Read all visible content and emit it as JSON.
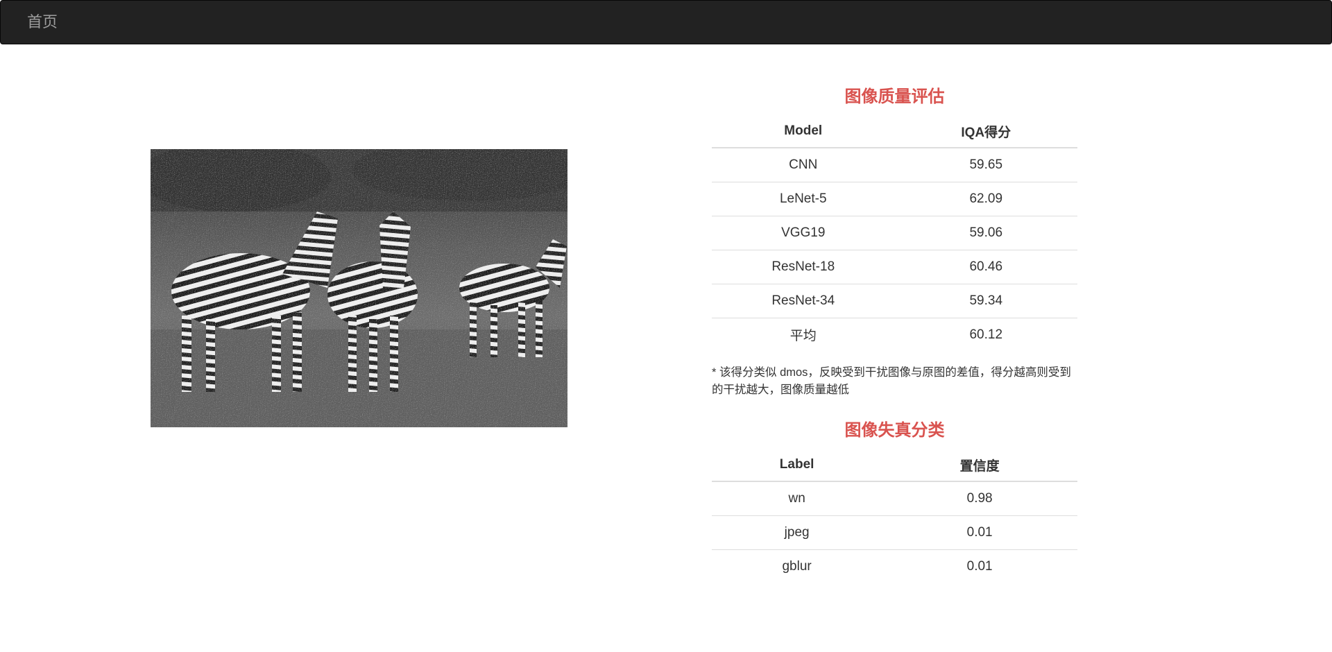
{
  "navbar": {
    "brand": "首页"
  },
  "image": {
    "alt": "zebras-noisy-grayscale-photo"
  },
  "iqa": {
    "title": "图像质量评估",
    "columns": [
      "Model",
      "IQA得分"
    ],
    "rows": [
      [
        "CNN",
        "59.65"
      ],
      [
        "LeNet-5",
        "62.09"
      ],
      [
        "VGG19",
        "59.06"
      ],
      [
        "ResNet-18",
        "60.46"
      ],
      [
        "ResNet-34",
        "59.34"
      ],
      [
        "平均",
        "60.12"
      ]
    ],
    "note": "* 该得分类似 dmos，反映受到干扰图像与原图的差值，得分越高则受到的干扰越大，图像质量越低"
  },
  "distortion": {
    "title": "图像失真分类",
    "columns": [
      "Label",
      "置信度"
    ],
    "rows": [
      [
        "wn",
        "0.98"
      ],
      [
        "jpeg",
        "0.01"
      ],
      [
        "gblur",
        "0.01"
      ]
    ]
  },
  "colors": {
    "navbar_bg": "#222222",
    "navbar_text": "#9d9d9d",
    "heading": "#d9534f",
    "border": "#dddddd"
  }
}
